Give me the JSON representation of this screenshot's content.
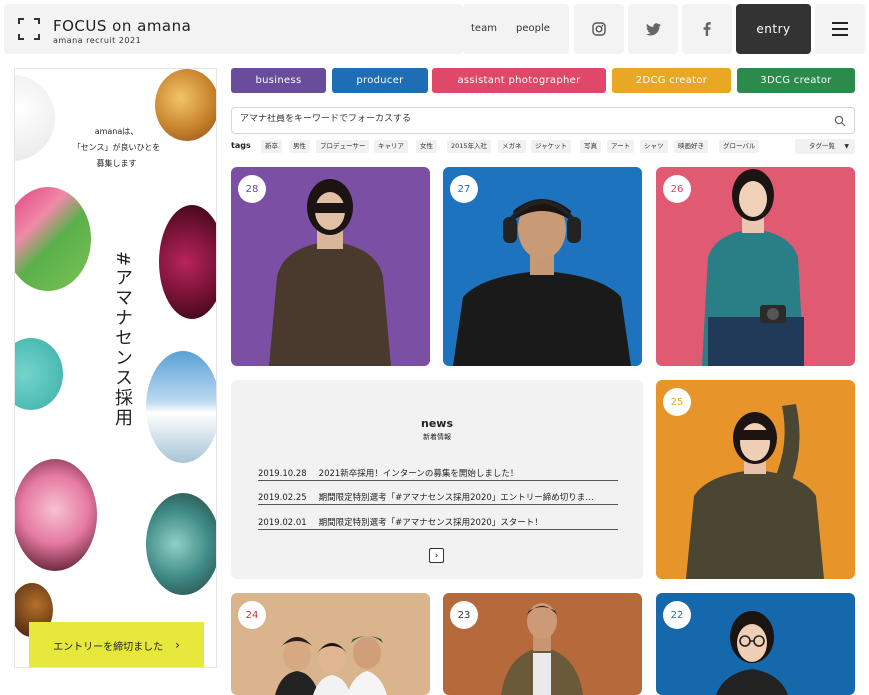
{
  "header": {
    "logo_title": "FOCUS on amana",
    "logo_subtitle": "amana recruit 2021",
    "nav": {
      "team": "team",
      "people": "people"
    },
    "entry_label": "entry"
  },
  "banner": {
    "copy_line1": "amanaは、",
    "copy_line2": "「センス」が良いひとを",
    "copy_line3": "募集します",
    "vertical_title": "#アマナセンス採用",
    "cta_label": "エントリーを締切ました",
    "cta_arrow": "›"
  },
  "categories": [
    {
      "label": "business",
      "color": "#6a4c9c"
    },
    {
      "label": "producer",
      "color": "#1e6db5"
    },
    {
      "label": "assistant photographer",
      "color": "#e0486a"
    },
    {
      "label": "2DCG creator",
      "color": "#e8a826"
    },
    {
      "label": "3DCG creator",
      "color": "#2c8a4b"
    }
  ],
  "search": {
    "placeholder": "アマナ社員をキーワードでフォーカスする"
  },
  "tags": {
    "label": "tags",
    "items": [
      "新卒",
      "男性",
      "プロデューサー",
      "キャリア",
      "女性",
      "2015年入社",
      "メガネ",
      "ジャケット",
      "写真",
      "アート",
      "シャツ",
      "映画好き",
      "グローバル"
    ],
    "dropdown_label": "タグ一覧",
    "dropdown_caret": "▼"
  },
  "cards": [
    {
      "number": "28",
      "bg": "#7b4fa3",
      "num_color": "#6a4c9c"
    },
    {
      "number": "27",
      "bg": "#1e73be",
      "num_color": "#1e6db5"
    },
    {
      "number": "26",
      "bg": "#e05a72",
      "num_color": "#d9435f"
    },
    {
      "number": "25",
      "bg": "#e7952b",
      "num_color": "#e8a826"
    },
    {
      "number": "24",
      "bg": "#d9b48c",
      "num_color": "#c0392b"
    },
    {
      "number": "23",
      "bg": "#b66a3c",
      "num_color": "#333333"
    },
    {
      "number": "22",
      "bg": "#1668ad",
      "num_color": "#1e6db5"
    }
  ],
  "news": {
    "title": "news",
    "subtitle": "新着情報",
    "items": [
      {
        "date": "2019.10.28",
        "text": "2021新卒採用！インターンの募集を開始しました！"
      },
      {
        "date": "2019.02.25",
        "text": "期間限定特別選考「#アマナセンス採用2020」エントリー締め切りま…"
      },
      {
        "date": "2019.02.01",
        "text": "期間限定特別選考「#アマナセンス採用2020」スタート！"
      }
    ],
    "more_icon": "›"
  }
}
